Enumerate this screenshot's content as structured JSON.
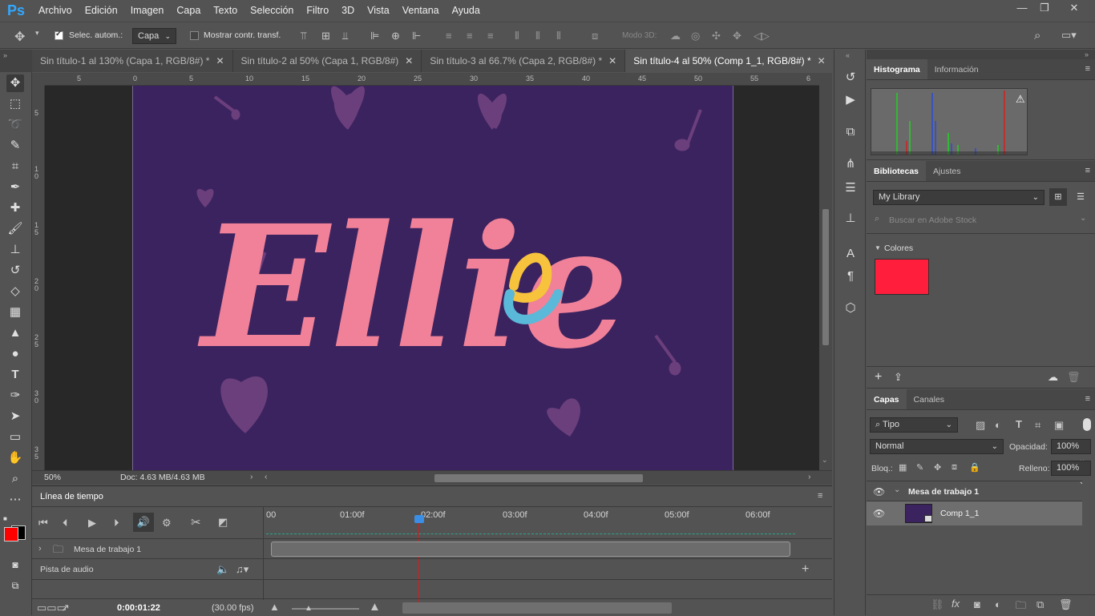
{
  "app": {
    "logo": "Ps"
  },
  "menu": [
    "Archivo",
    "Edición",
    "Imagen",
    "Capa",
    "Texto",
    "Selección",
    "Filtro",
    "3D",
    "Vista",
    "Ventana",
    "Ayuda"
  ],
  "window_controls": {
    "minimize": "—",
    "restore": "❐",
    "close": "✕"
  },
  "options": {
    "auto_select_label": "Selec. autom.:",
    "auto_select_checked": true,
    "auto_select_target": "Capa",
    "show_transform_label": "Mostrar contr. transf.",
    "show_transform_checked": false,
    "mode3d_label": "Modo 3D:"
  },
  "doc_tabs": [
    {
      "label": "Sin título-1 al 130% (Capa 1, RGB/8#)",
      "dirty": "*",
      "active": false
    },
    {
      "label": "Sin título-2 al 50% (Capa 1, RGB/8#)",
      "dirty": "",
      "active": false
    },
    {
      "label": "Sin título-3 al 66.7% (Capa 2, RGB/8#)",
      "dirty": "*",
      "active": false
    },
    {
      "label": "Sin título-4 al 50% (Comp 1_1, RGB/8#)",
      "dirty": "*",
      "active": true
    }
  ],
  "ruler_h": [
    "5",
    "0",
    "5",
    "10",
    "15",
    "20",
    "25",
    "30",
    "35",
    "40",
    "45",
    "50",
    "55",
    "6"
  ],
  "ruler_v": [
    "5",
    "1 0",
    "1 5",
    "2 0",
    "2 5",
    "3 0",
    "3 5"
  ],
  "canvas": {
    "artboard_color": "#3b235f",
    "title_text": "Ellie",
    "title_color": "#f08198",
    "accent_yellow": "#f7c23c",
    "accent_blue": "#5ab8d8",
    "decor_color": "#6b3f7c"
  },
  "status": {
    "zoom": "50%",
    "doc": "Doc: 4.63 MB/4.63 MB"
  },
  "timeline": {
    "title": "Línea de tiempo",
    "time_labels": [
      "00",
      "01:00f",
      "02:00f",
      "03:00f",
      "04:00f",
      "05:00f",
      "06:00f"
    ],
    "playhead_fraction": 0.29,
    "track_group": "Mesa de trabajo 1",
    "audio_track": "Pista de audio",
    "current_time": "0:00:01:22",
    "fps": "(30.00 fps)"
  },
  "histogram": {
    "tabs": [
      "Histograma",
      "Información"
    ],
    "warning": "⚠"
  },
  "libraries": {
    "tabs": [
      "Bibliotecas",
      "Ajustes"
    ],
    "library": "My Library",
    "search_placeholder": "Buscar en Adobe Stock",
    "section": "Colores",
    "swatch": "#ff1f3d"
  },
  "layers": {
    "tabs": [
      "Capas",
      "Canales"
    ],
    "filter": "Tipo",
    "blend_mode": "Normal",
    "opacity_label": "Opacidad:",
    "opacity": "100%",
    "lock_label": "Bloq.:",
    "fill_label": "Relleno:",
    "fill": "100%",
    "group": "Mesa de trabajo 1",
    "layer": "Comp 1_1"
  },
  "colors": {
    "foreground": "#ff0000",
    "background": "#000000",
    "accent": "#31a8ff"
  }
}
